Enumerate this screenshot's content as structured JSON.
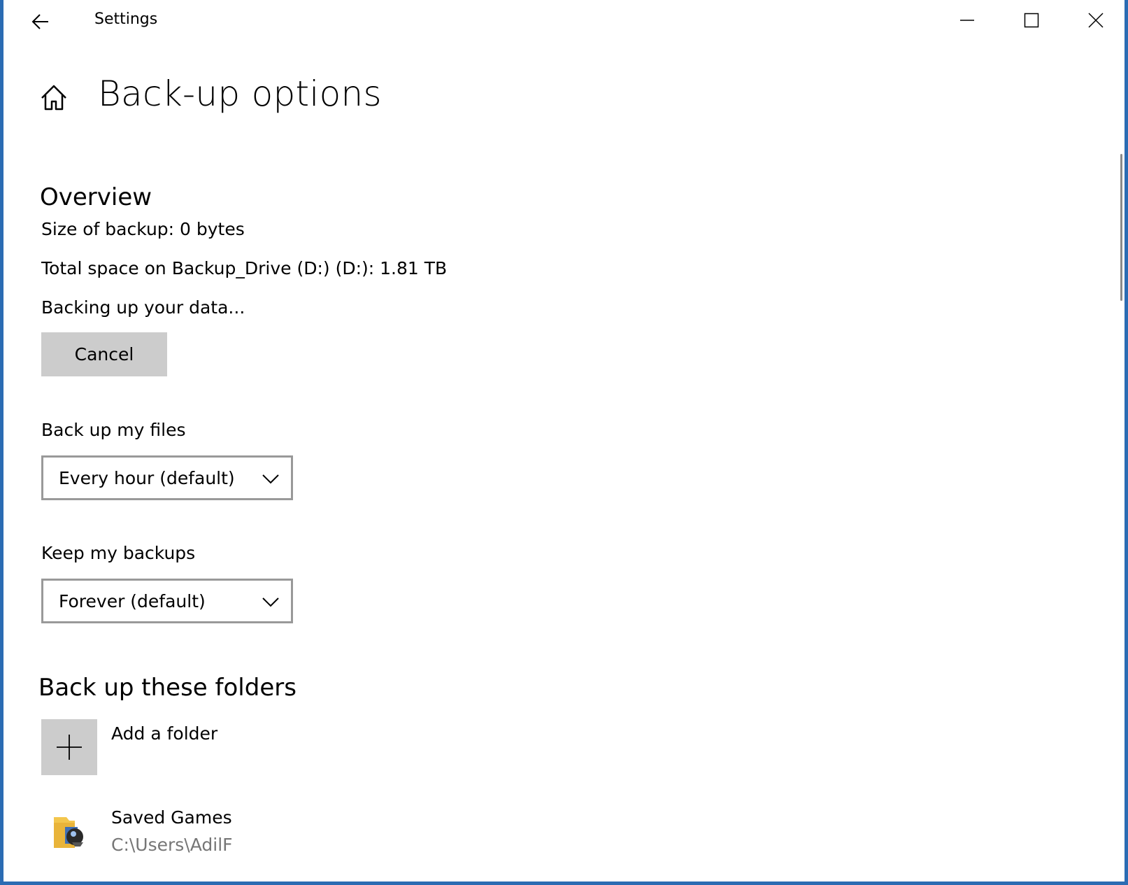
{
  "window": {
    "title": "Settings"
  },
  "header": {
    "page_title": "Back-up options"
  },
  "overview": {
    "heading": "Overview",
    "size_of_backup": "Size of backup: 0 bytes",
    "total_space": "Total space on Backup_Drive (D:) (D:): 1.81 TB",
    "status": "Backing up your data...",
    "cancel_label": "Cancel"
  },
  "backup_frequency": {
    "label": "Back up my files",
    "selected": "Every hour (default)"
  },
  "retention": {
    "label": "Keep my backups",
    "selected": "Forever (default)"
  },
  "folders": {
    "heading": "Back up these folders",
    "add_label": "Add a folder",
    "items": [
      {
        "name": "Saved Games",
        "path": "C:\\Users\\AdilF"
      }
    ]
  },
  "icons": {
    "back": "back-arrow-icon",
    "minimize": "minimize-icon",
    "maximize": "maximize-icon",
    "close": "close-icon",
    "home": "home-icon",
    "chevron": "chevron-down-icon",
    "add": "plus-icon",
    "folder": "saved-games-folder-icon"
  },
  "colors": {
    "window_border": "#2b6cb3",
    "button_gray": "#cccccc",
    "dropdown_border": "#999999",
    "secondary_text": "#767676"
  }
}
